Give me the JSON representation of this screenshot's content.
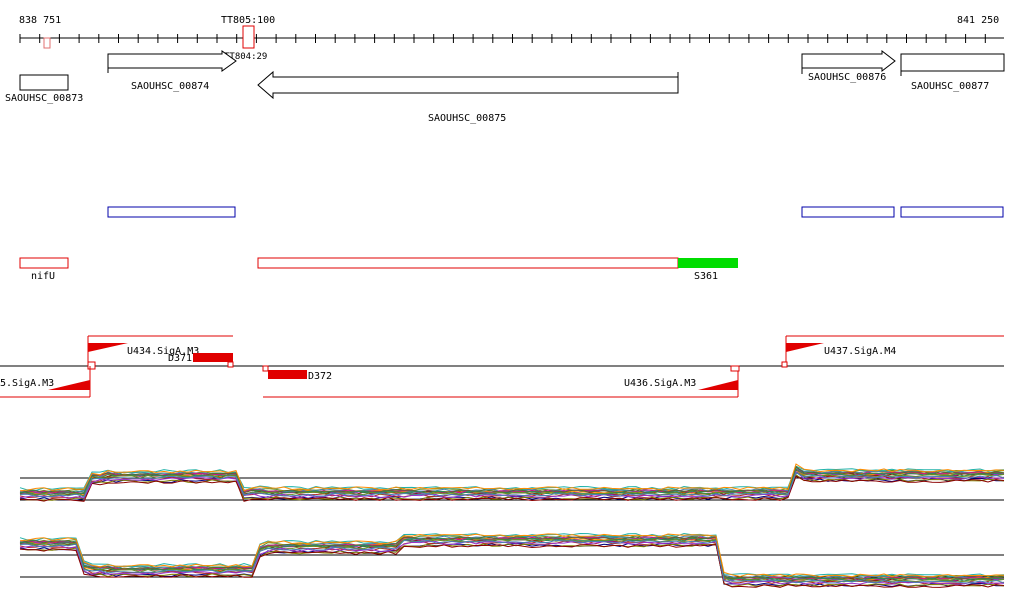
{
  "coords": {
    "start": "838 751",
    "end": "841 250",
    "marker": "TT805:100",
    "marker_sub": "TT804:29"
  },
  "genes": [
    {
      "id": "SAOUHSC_00873",
      "strand": "none"
    },
    {
      "id": "SAOUHSC_00874",
      "strand": "+"
    },
    {
      "id": "SAOUHSC_00875",
      "strand": "-"
    },
    {
      "id": "SAOUHSC_00876",
      "strand": "+"
    },
    {
      "id": "SAOUHSC_00877",
      "strand": "none"
    }
  ],
  "features": {
    "nif": "nifU",
    "srna": "S361"
  },
  "operons": {
    "u434": "U434.SigA.M3",
    "u435": "5.SigA.M3",
    "u436": "U436.SigA.M3",
    "u437": "U437.SigA.M4",
    "d371": "D371",
    "d372": "D372"
  },
  "colors": {
    "feature_red": "#e00000",
    "cds_blue": "#0000aa",
    "srna_green": "#00dd00",
    "profile_lines": [
      "#8b0000",
      "#2e8b57",
      "#6b8e23",
      "#9932cc",
      "#ff8c00",
      "#4682b4",
      "#000080",
      "#b22222",
      "#808000",
      "#20b2aa",
      "#c71585",
      "#556b2f"
    ]
  }
}
